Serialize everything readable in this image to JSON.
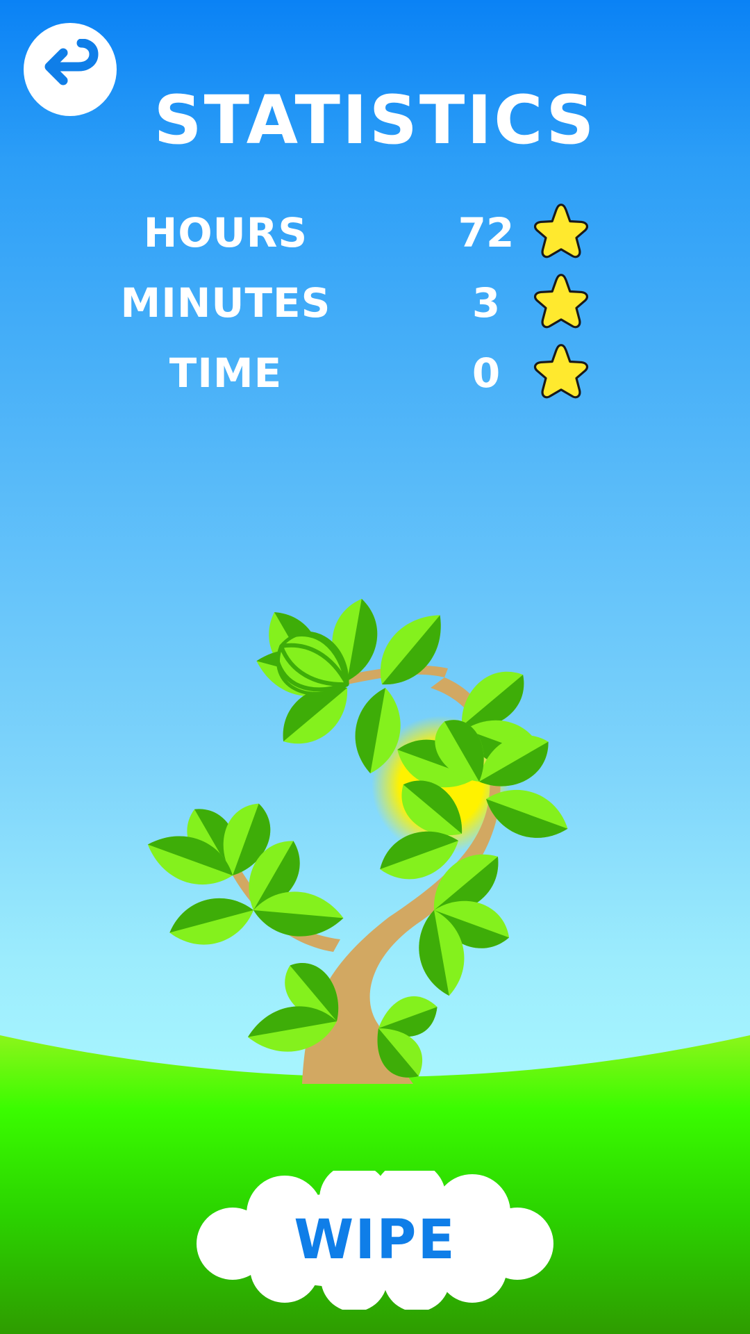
{
  "header": {
    "title": "STATISTICS",
    "back_icon": "back-arrow-icon"
  },
  "stats": [
    {
      "label": "HOURS",
      "value": "72",
      "icon": "star-icon"
    },
    {
      "label": "MINUTES",
      "value": "3",
      "icon": "star-icon"
    },
    {
      "label": "TIME",
      "value": "0",
      "icon": "star-icon"
    }
  ],
  "actions": {
    "wipe_label": "WIPE"
  },
  "colors": {
    "sky_top": "#0a82f5",
    "sky_bottom": "#a6f4fe",
    "grass_light": "#8cf51a",
    "grass_dark": "#2e9c00",
    "star_fill": "#ffe92e",
    "trunk": "#d2a862",
    "leaf_light": "#84f11d",
    "leaf_dark": "#3ead08",
    "button_text": "#0f7ee8"
  }
}
